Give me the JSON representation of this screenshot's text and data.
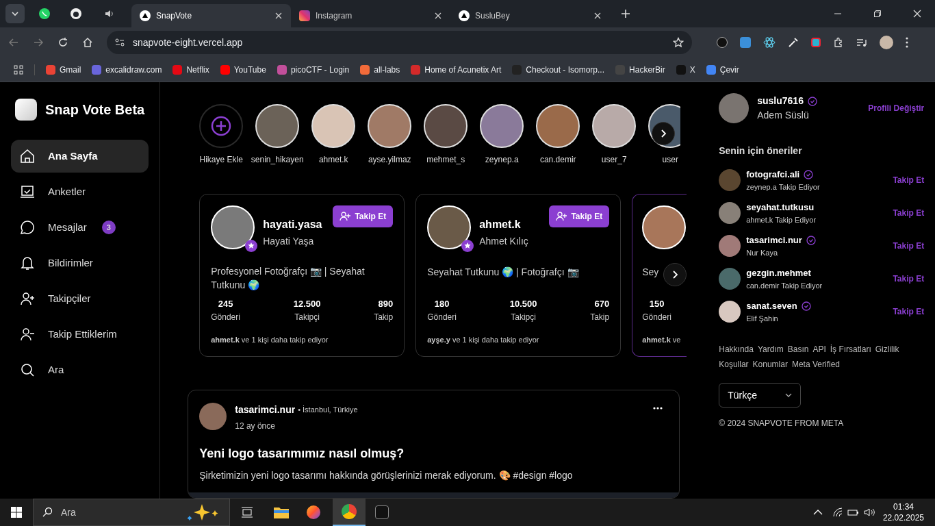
{
  "browser": {
    "tabs": [
      {
        "title": "SnapVote",
        "selected": true
      },
      {
        "title": "Instagram",
        "selected": false
      },
      {
        "title": "SusluBey",
        "selected": false
      }
    ],
    "address": "snapvote-eight.vercel.app",
    "bookmarks": [
      {
        "label": "Gmail",
        "color": "#ea4335"
      },
      {
        "label": "excalidraw.com",
        "color": "#6965db"
      },
      {
        "label": "Netflix",
        "color": "#e50914"
      },
      {
        "label": "YouTube",
        "color": "#ff0000"
      },
      {
        "label": "picoCTF - Login",
        "color": "#c24f9b"
      },
      {
        "label": "all-labs",
        "color": "#f26b3a"
      },
      {
        "label": "Home of Acunetix Art",
        "color": "#d42a2a"
      },
      {
        "label": "Checkout - Isomorp...",
        "color": "#222222"
      },
      {
        "label": "HackerBir",
        "color": "#444444"
      },
      {
        "label": "X",
        "color": "#111111"
      },
      {
        "label": "Çevir",
        "color": "#4285f4"
      }
    ]
  },
  "sidebar": {
    "brand": "Snap Vote Beta",
    "items": [
      {
        "label": "Ana Sayfa",
        "selected": true
      },
      {
        "label": "Anketler",
        "selected": false
      },
      {
        "label": "Mesajlar",
        "selected": false,
        "badge": "3"
      },
      {
        "label": "Bildirimler",
        "selected": false
      },
      {
        "label": "Takipçiler",
        "selected": false
      },
      {
        "label": "Takip Ettiklerim",
        "selected": false
      },
      {
        "label": "Ara",
        "selected": false
      }
    ]
  },
  "stories": [
    {
      "label": "Hikaye Ekle",
      "kind": "add"
    },
    {
      "label": "senin_hikayen",
      "kind": "user"
    },
    {
      "label": "ahmet.k",
      "kind": "user"
    },
    {
      "label": "ayse.yilmaz",
      "kind": "user"
    },
    {
      "label": "mehmet_s",
      "kind": "user"
    },
    {
      "label": "zeynep.a",
      "kind": "user"
    },
    {
      "label": "can.demir",
      "kind": "user"
    },
    {
      "label": "user_7",
      "kind": "user"
    },
    {
      "label": "user",
      "kind": "user"
    }
  ],
  "suggested_cards": [
    {
      "username": "hayati.yasa",
      "name": "Hayati Yaşa",
      "button": "Takip Et",
      "bio": "Profesyonel Fotoğrafçı 📷 | Seyahat Tutkunu 🌍",
      "stats": [
        {
          "value": "245",
          "label": "Gönderi"
        },
        {
          "value": "12.500",
          "label": "Takipçi"
        },
        {
          "value": "890",
          "label": "Takip"
        }
      ],
      "followed_by": "**ahmet.k** ve 1 kişi daha takip ediyor"
    },
    {
      "username": "ahmet.k",
      "name": "Ahmet Kılıç",
      "button": "Takip Et",
      "bio": "Seyahat Tutkunu 🌍 | Fotoğrafçı 📷",
      "stats": [
        {
          "value": "180",
          "label": "Gönderi"
        },
        {
          "value": "10.500",
          "label": "Takipçi"
        },
        {
          "value": "670",
          "label": "Takip"
        }
      ],
      "followed_by": "**ayşe.y** ve 1 kişi daha takip ediyor"
    },
    {
      "bio": "Sey",
      "stats": [
        {
          "value": "150",
          "label": "Gönderi"
        }
      ],
      "followed_by": "**ahmet.k** ve"
    }
  ],
  "post": {
    "username": "tasarimci.nur",
    "location": "• İstanbul, Türkiye",
    "time": "12 ay önce",
    "title": "Yeni logo tasarımımız nasıl olmuş?",
    "body": "Şirketimizin yeni logo tasarımı hakkında görüşlerinizi merak ediyorum. 🎨 #design #logo"
  },
  "profile": {
    "username": "suslu7616",
    "name": "Adem Süslü",
    "verified": true,
    "action": "Profili Değiştir"
  },
  "suggestions": {
    "title": "Senin için öneriler",
    "items": [
      {
        "username": "fotografci.ali",
        "subtitle": "zeynep.a Takip Ediyor",
        "verified": true,
        "action": "Takip Et"
      },
      {
        "username": "seyahat.tutkusu",
        "subtitle": "ahmet.k Takip Ediyor",
        "verified": false,
        "action": "Takip Et"
      },
      {
        "username": "tasarimci.nur",
        "subtitle": "Nur Kaya",
        "verified": true,
        "action": "Takip Et"
      },
      {
        "username": "gezgin.mehmet",
        "subtitle": "can.demir Takip Ediyor",
        "verified": false,
        "action": "Takip Et"
      },
      {
        "username": "sanat.seven",
        "subtitle": "Elif Şahin",
        "verified": true,
        "action": "Takip Et"
      }
    ]
  },
  "footer_links": [
    "Hakkında",
    "Yardım",
    "Basın",
    "API",
    "İş Fırsatları",
    "Gizlilik",
    "Koşullar",
    "Konumlar",
    "Meta Verified"
  ],
  "language": "Türkçe",
  "copyright": "© 2024 SNAPVOTE FROM META",
  "taskbar": {
    "search_placeholder": "Ara",
    "time": "01:34",
    "date": "22.02.2025"
  }
}
